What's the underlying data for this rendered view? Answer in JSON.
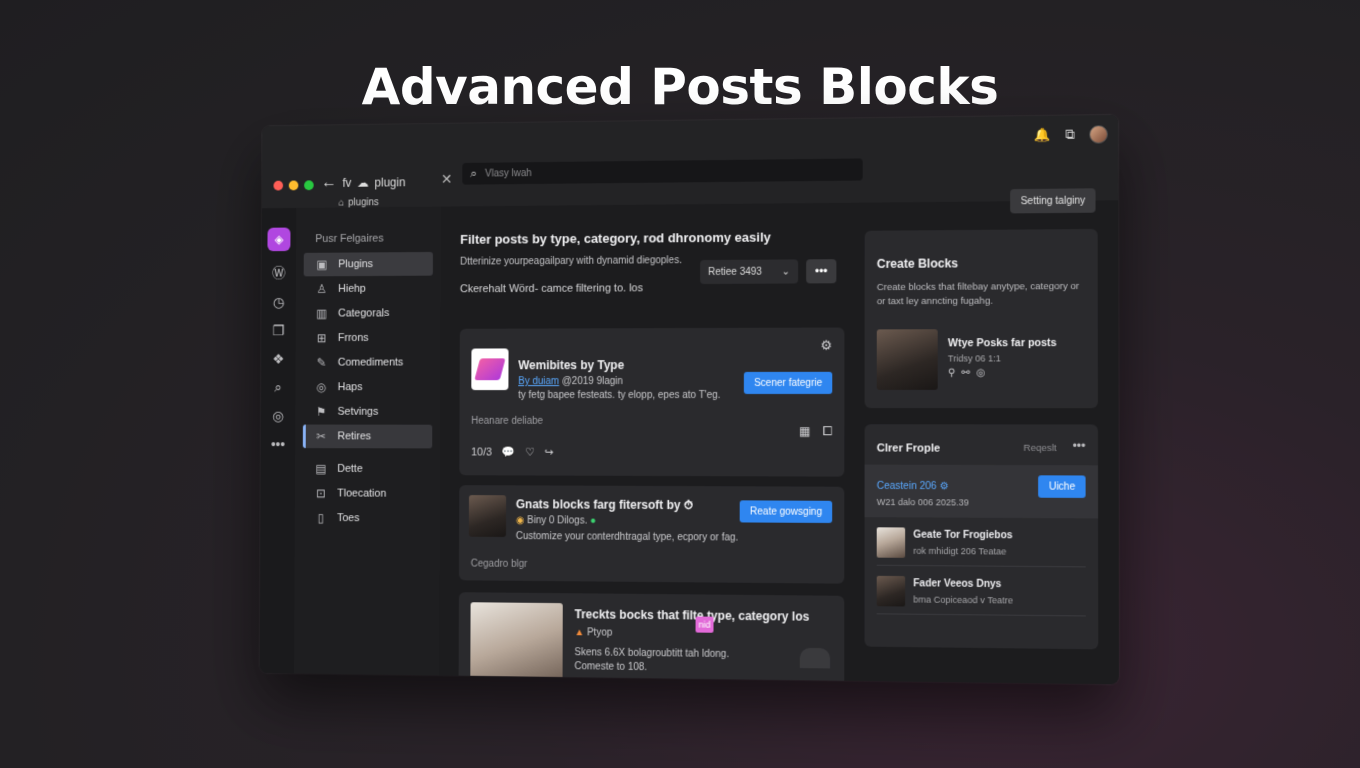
{
  "hero_title": "Advanced Posts Blocks",
  "titlebar": {
    "tab_title": "fv",
    "tab_title_brand": "plugin",
    "tab_sub": "plugins",
    "search_placeholder": "Vlasy lwah",
    "setting_button": "Setting talginy"
  },
  "rail": {
    "icons": [
      "plugin-logo-icon",
      "wordpress-icon",
      "clock-icon",
      "pages-icon",
      "grid-icon",
      "search-icon",
      "globe-icon",
      "more-icon"
    ]
  },
  "sidebar": {
    "heading": "Pusr Felgaires",
    "items": [
      {
        "label": "Plugins",
        "icon": "plugin-icon"
      },
      {
        "label": "Hiehp",
        "icon": "user-icon"
      },
      {
        "label": "Categorals",
        "icon": "chart-icon"
      },
      {
        "label": "Frrons",
        "icon": "grid-icon"
      },
      {
        "label": "Comediments",
        "icon": "pin-icon"
      },
      {
        "label": "Haps",
        "icon": "globe-icon"
      },
      {
        "label": "Setvings",
        "icon": "flag-icon"
      },
      {
        "label": "Retires",
        "icon": "tools-icon"
      },
      {
        "label": "Dette",
        "icon": "table-icon"
      },
      {
        "label": "Tloecation",
        "icon": "box-icon"
      },
      {
        "label": "Toes",
        "icon": "doc-icon"
      }
    ]
  },
  "main": {
    "title": "Filter posts by type, category, rod dhronomy easily",
    "subtitle": "Dtterinize yourpeagailpary with dynamid diegoples.",
    "row3": "Ckerehalt Wörd- camce filtering to. los",
    "select_label": "Retiee 3493",
    "more": "•••",
    "card1": {
      "title": "Wemibites by Type",
      "meta_link": "By duiam",
      "meta_rest": "@2019 9lagin",
      "meta_line2": "ty fetg bapee festeats. ty elopp, epes ato T'eg.",
      "button": "Scener fategrie",
      "note": "Heanare deliabe",
      "stats": "10/3"
    },
    "card2": {
      "title": "Gnats blocks farg fitersoft by",
      "meta": "Biny   0 Dilogs.",
      "desc": "Customize your conterdhtragal type, ecpory or fag.",
      "button": "Reate gowsging",
      "note": "Cegadro blgr"
    },
    "card3": {
      "title": "Treckts bocks that filte type, category los",
      "meta": "Ptyop",
      "tag": "nid",
      "desc": "Skens 6.6X bolagroubtitt tah ldong.",
      "desc2": "Comeste to 108."
    }
  },
  "right": {
    "panel1": {
      "title": "Create Blocks",
      "desc": "Create blocks that filtebay anytype, category or or taxt ley anncting fugahg.",
      "item_title": "Wtye Posks far posts",
      "item_sub": "Tridsy 06 1:1"
    },
    "panel2": {
      "title": "Clrer Frople",
      "request": "Reqeslt",
      "more": "•••",
      "link": "Ceastein 206",
      "date": "W21 dalo 006 2025.39",
      "button": "Uiche",
      "items": [
        {
          "title": "Geate Tor Frogiebos",
          "sub": "rok mhidigt 206 Teatae"
        },
        {
          "title": "Fader Veeos Dnys",
          "sub": "bma Copiceaod v Teatre"
        }
      ]
    }
  },
  "colors": {
    "accent_blue": "#2f86f0",
    "brand_purple": "#b047e0",
    "link_blue": "#5aa9ff"
  }
}
